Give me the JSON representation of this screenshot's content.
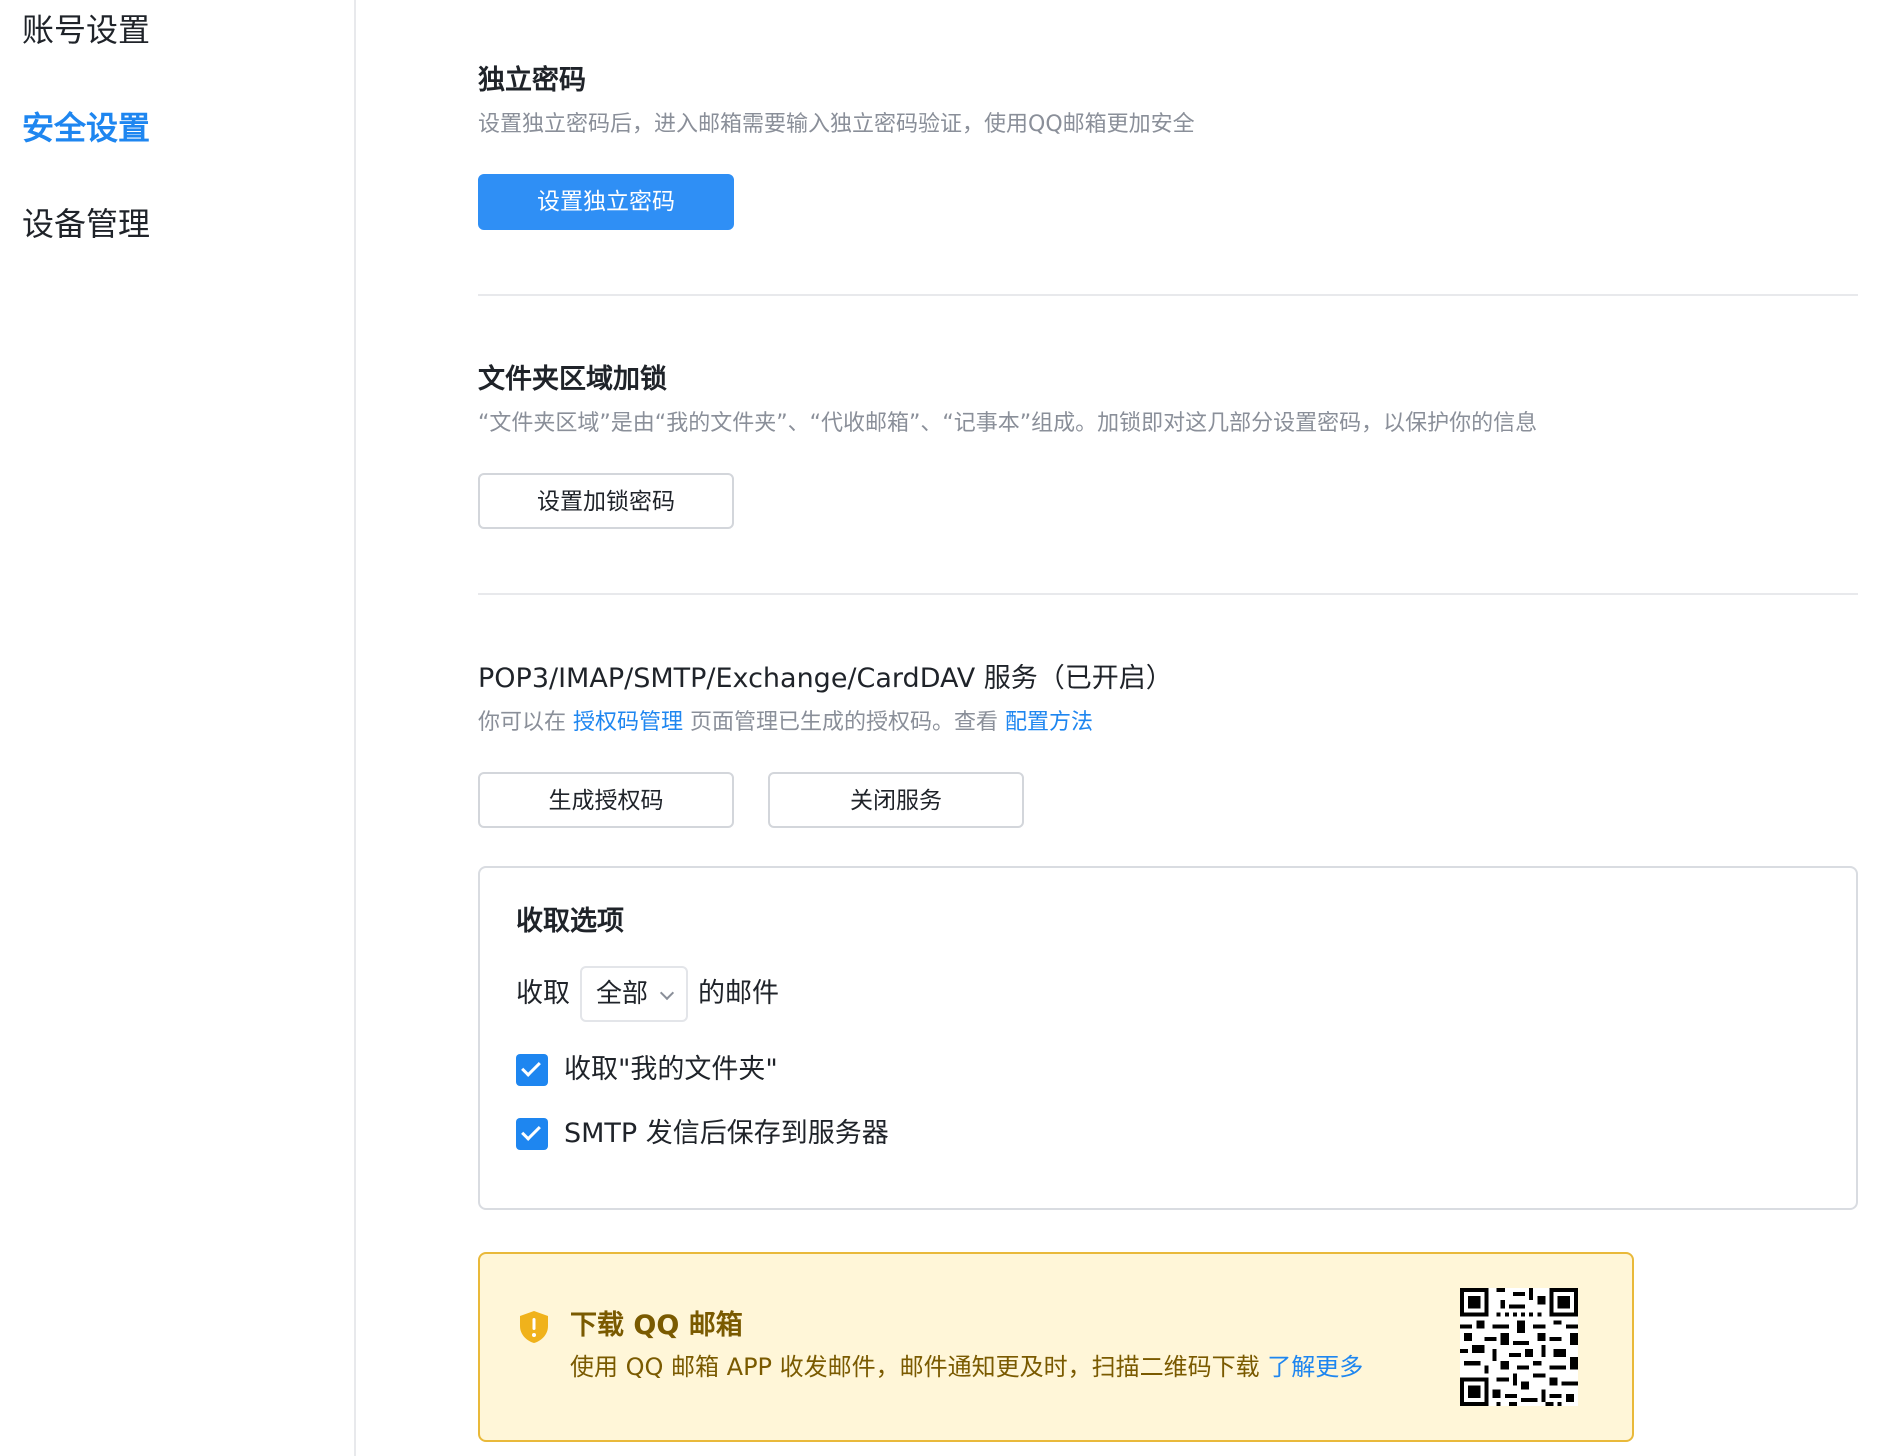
{
  "sidebar": {
    "items": [
      {
        "label": "账号设置",
        "active": false
      },
      {
        "label": "安全设置",
        "active": true
      },
      {
        "label": "设备管理",
        "active": false
      }
    ]
  },
  "independent_password": {
    "title": "独立密码",
    "description": "设置独立密码后，进入邮箱需要输入独立密码验证，使用QQ邮箱更加安全",
    "button_label": "设置独立密码"
  },
  "folder_lock": {
    "title": "文件夹区域加锁",
    "description": "“文件夹区域”是由“我的文件夹”、“代收邮箱”、“记事本”组成。加锁即对这几部分设置密码，以保护你的信息",
    "button_label": "设置加锁密码"
  },
  "services": {
    "title": "POP3/IMAP/SMTP/Exchange/CardDAV 服务（已开启）",
    "desc_prefix": "你可以在 ",
    "auth_link": "授权码管理",
    "desc_middle": " 页面管理已生成的授权码。查看 ",
    "config_link": "配置方法",
    "generate_button": "生成授权码",
    "close_button": "关闭服务"
  },
  "receive_options": {
    "title": "收取选项",
    "prefix": "收取",
    "selected": "全部",
    "suffix": "的邮件",
    "checkboxes": [
      {
        "label": "收取\"我的文件夹\"",
        "checked": true
      },
      {
        "label": "SMTP 发信后保存到服务器",
        "checked": true
      }
    ]
  },
  "promo": {
    "title": "下载 QQ 邮箱",
    "description": "使用 QQ 邮箱 APP 收发邮件，邮件通知更及时，扫描二维码下载 ",
    "link": "了解更多",
    "icon": "shield-icon"
  },
  "colors": {
    "accent": "#1e86f0",
    "promo_bg": "#fff6d8",
    "promo_border": "#e9b93a",
    "promo_text": "#7a5a00"
  }
}
